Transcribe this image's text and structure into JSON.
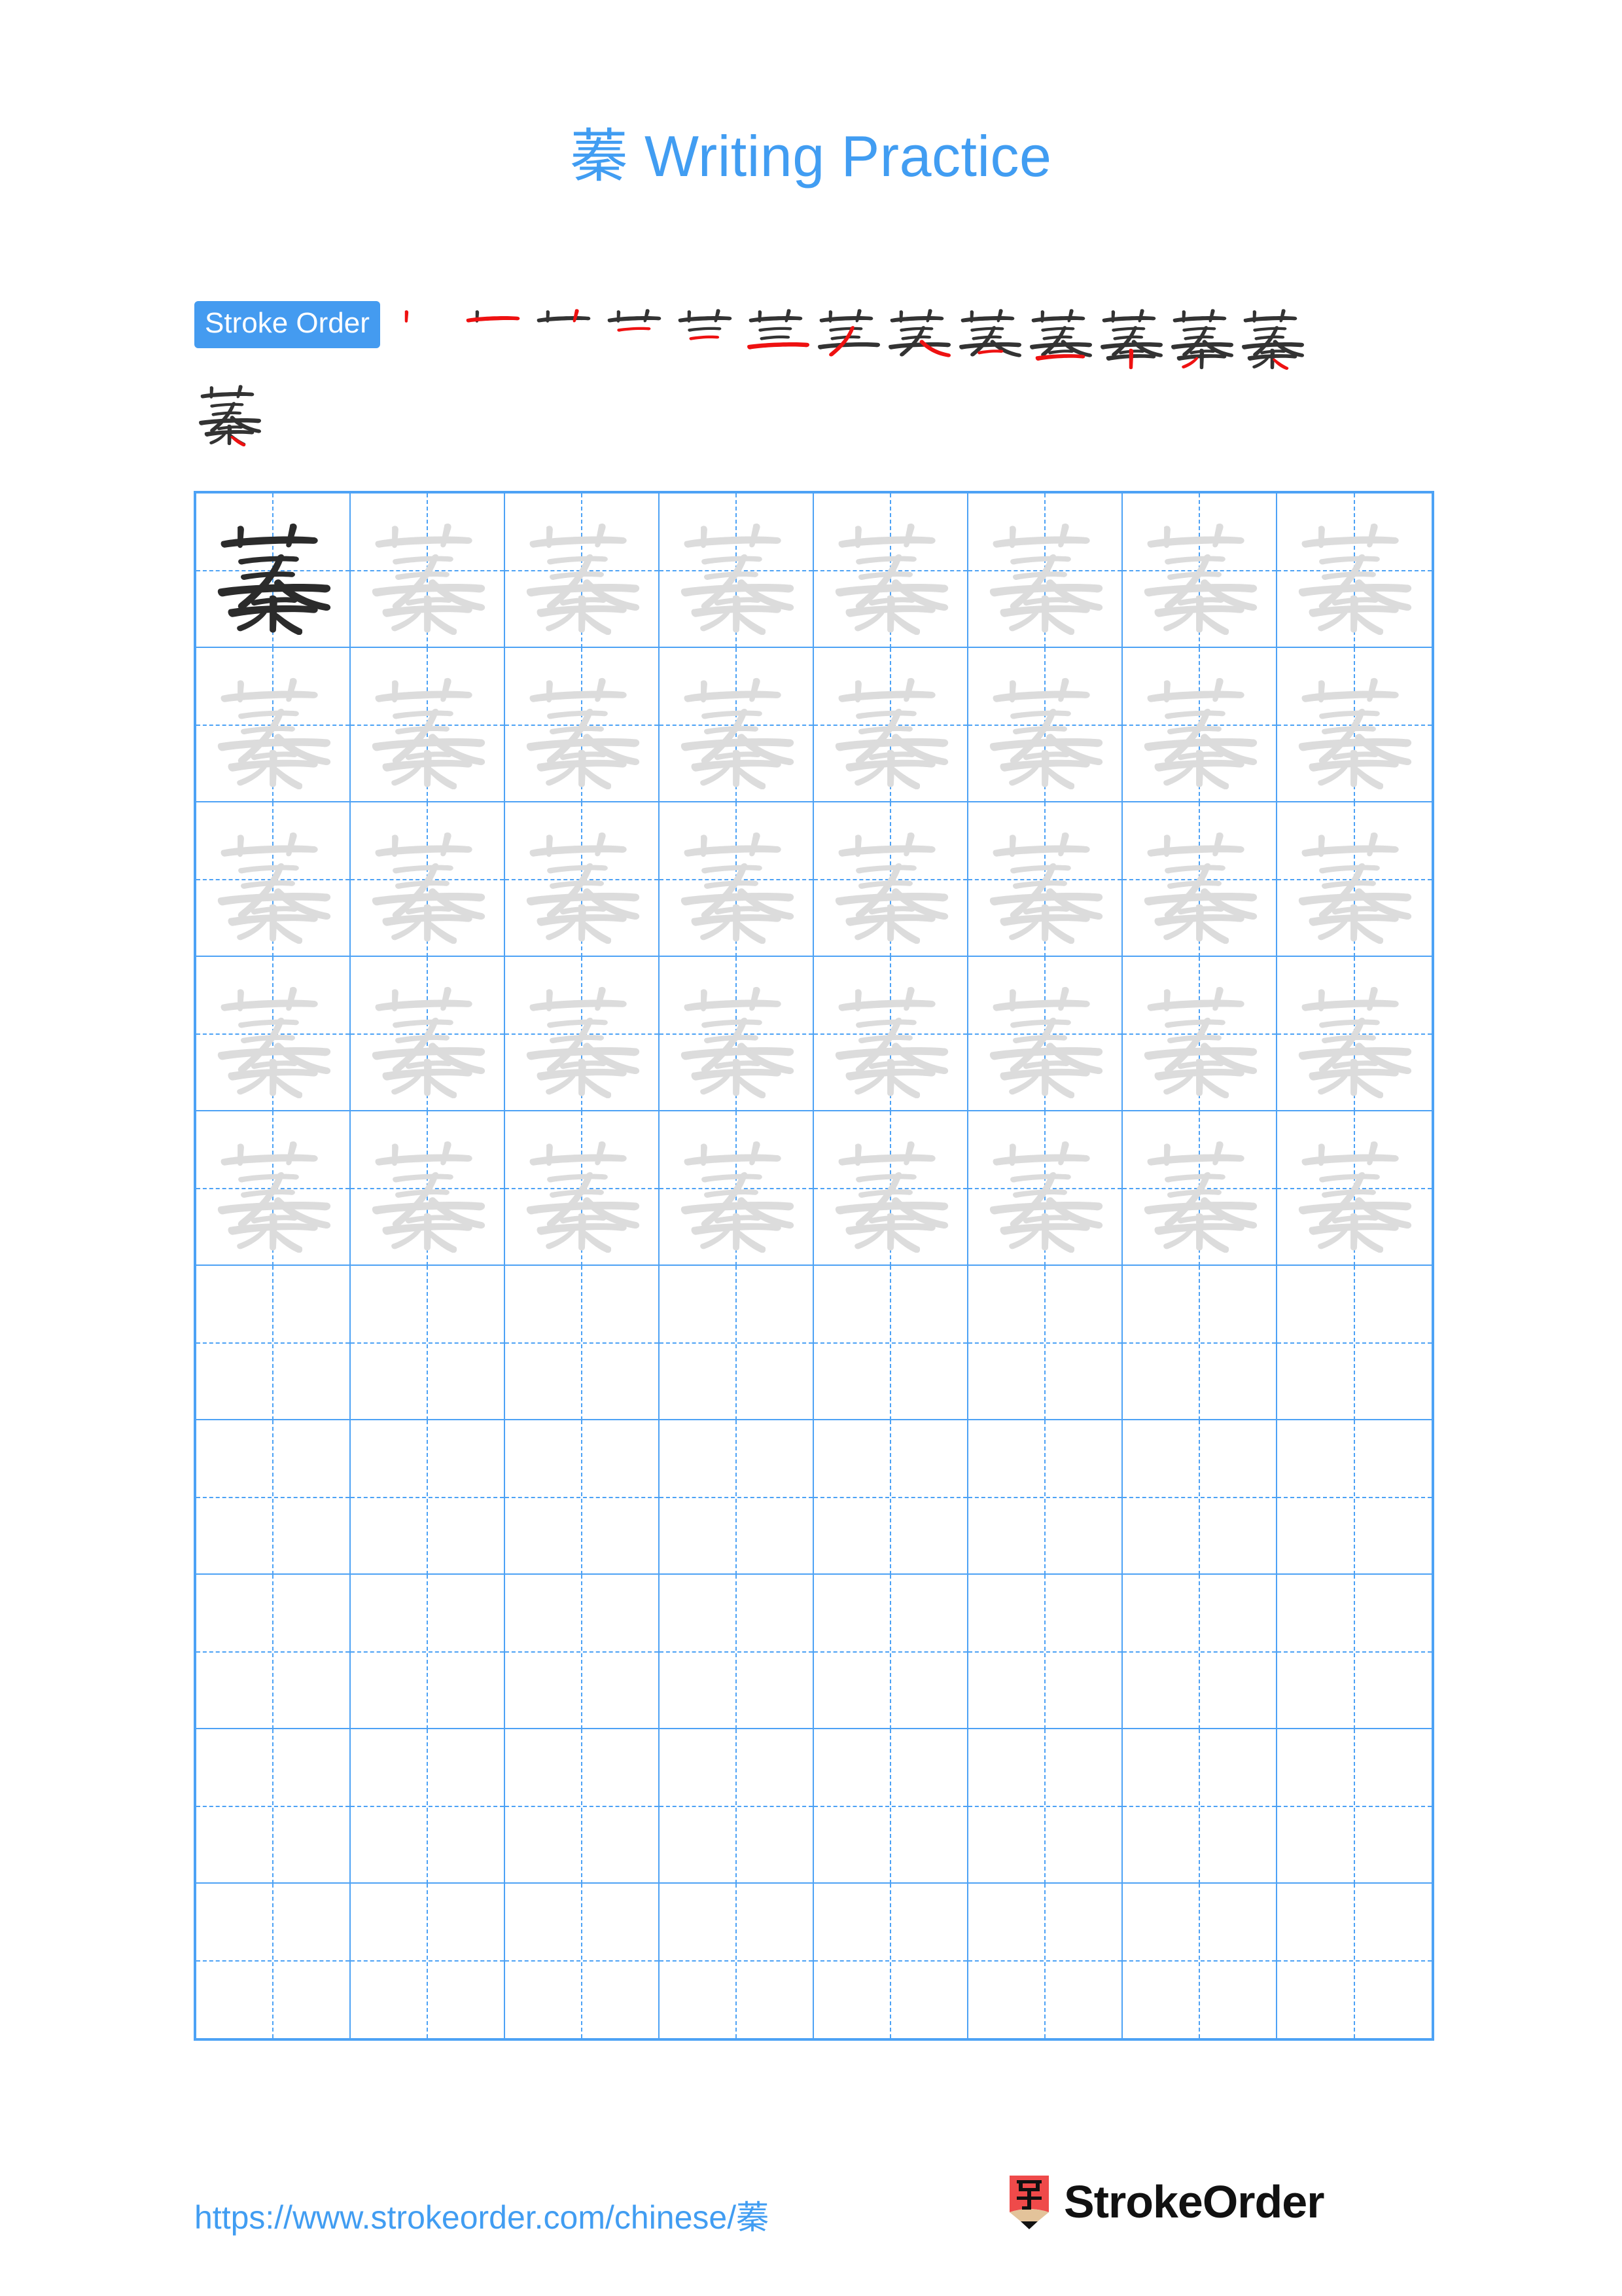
{
  "page": {
    "character": "蓁",
    "title_suffix": " Writing Practice",
    "title_full": "蓁 Writing Practice",
    "accent_color": "#419df2",
    "grid_color": "#4da2f5",
    "stroke_new_color": "#ee1111",
    "stroke_prev_color": "#333333",
    "trace_color": "#dcdcdc",
    "ink_color": "#2b2b2b"
  },
  "stroke_order": {
    "badge_label": "Stroke Order",
    "total_strokes": 14,
    "steps": [
      {
        "index": 1,
        "strokes_shown": 1
      },
      {
        "index": 2,
        "strokes_shown": 2
      },
      {
        "index": 3,
        "strokes_shown": 3
      },
      {
        "index": 4,
        "strokes_shown": 4
      },
      {
        "index": 5,
        "strokes_shown": 5
      },
      {
        "index": 6,
        "strokes_shown": 6
      },
      {
        "index": 7,
        "strokes_shown": 7
      },
      {
        "index": 8,
        "strokes_shown": 8
      },
      {
        "index": 9,
        "strokes_shown": 9
      },
      {
        "index": 10,
        "strokes_shown": 10
      },
      {
        "index": 11,
        "strokes_shown": 11
      },
      {
        "index": 12,
        "strokes_shown": 12
      },
      {
        "index": 13,
        "strokes_shown": 13
      },
      {
        "index": 14,
        "strokes_shown": 14
      }
    ]
  },
  "practice_grid": {
    "columns": 8,
    "rows": 10,
    "model_cell": {
      "row": 0,
      "col": 0,
      "style": "solid-ink"
    },
    "traced_rows": 5,
    "blank_rows": 5,
    "cells": [
      [
        "ink",
        "trace",
        "trace",
        "trace",
        "trace",
        "trace",
        "trace",
        "trace"
      ],
      [
        "trace",
        "trace",
        "trace",
        "trace",
        "trace",
        "trace",
        "trace",
        "trace"
      ],
      [
        "trace",
        "trace",
        "trace",
        "trace",
        "trace",
        "trace",
        "trace",
        "trace"
      ],
      [
        "trace",
        "trace",
        "trace",
        "trace",
        "trace",
        "trace",
        "trace",
        "trace"
      ],
      [
        "trace",
        "trace",
        "trace",
        "trace",
        "trace",
        "trace",
        "trace",
        "trace"
      ],
      [
        "blank",
        "blank",
        "blank",
        "blank",
        "blank",
        "blank",
        "blank",
        "blank"
      ],
      [
        "blank",
        "blank",
        "blank",
        "blank",
        "blank",
        "blank",
        "blank",
        "blank"
      ],
      [
        "blank",
        "blank",
        "blank",
        "blank",
        "blank",
        "blank",
        "blank",
        "blank"
      ],
      [
        "blank",
        "blank",
        "blank",
        "blank",
        "blank",
        "blank",
        "blank",
        "blank"
      ],
      [
        "blank",
        "blank",
        "blank",
        "blank",
        "blank",
        "blank",
        "blank",
        "blank"
      ]
    ]
  },
  "footer": {
    "url": "https://www.strokeorder.com/chinese/蓁",
    "logo_char": "字",
    "logo_text": "StrokeOrder",
    "logo_color": "#ef4a4a"
  }
}
